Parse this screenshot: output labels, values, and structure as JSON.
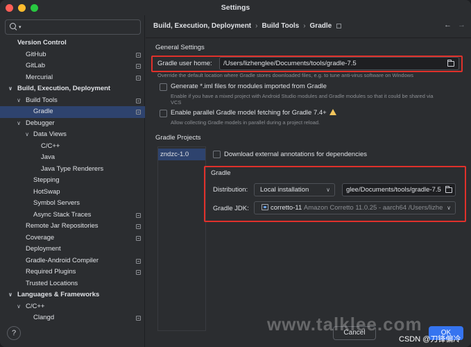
{
  "window": {
    "title": "Settings",
    "traffic_lights": {
      "close": "#ff5f57",
      "minimize": "#febc2e",
      "zoom": "#28c840"
    }
  },
  "sidebar": {
    "search": {
      "value": "",
      "icon": "search-icon"
    },
    "items": [
      {
        "label": "Version Control",
        "level": 1,
        "bold": true,
        "arrow": "",
        "page_icon": false,
        "selected": false
      },
      {
        "label": "GitHub",
        "level": 2,
        "bold": false,
        "arrow": "",
        "page_icon": true,
        "selected": false
      },
      {
        "label": "GitLab",
        "level": 2,
        "bold": false,
        "arrow": "",
        "page_icon": true,
        "selected": false
      },
      {
        "label": "Mercurial",
        "level": 2,
        "bold": false,
        "arrow": "",
        "page_icon": true,
        "selected": false
      },
      {
        "label": "Build, Execution, Deployment",
        "level": 1,
        "bold": true,
        "arrow": "∨",
        "page_icon": false,
        "selected": false
      },
      {
        "label": "Build Tools",
        "level": 2,
        "bold": false,
        "arrow": "∨",
        "page_icon": true,
        "selected": false
      },
      {
        "label": "Gradle",
        "level": 3,
        "bold": false,
        "arrow": "",
        "page_icon": true,
        "selected": true
      },
      {
        "label": "Debugger",
        "level": 2,
        "bold": false,
        "arrow": "∨",
        "page_icon": false,
        "selected": false
      },
      {
        "label": "Data Views",
        "level": 3,
        "bold": false,
        "arrow": "∨",
        "page_icon": false,
        "selected": false
      },
      {
        "label": "C/C++",
        "level": 4,
        "bold": false,
        "arrow": "",
        "page_icon": false,
        "selected": false
      },
      {
        "label": "Java",
        "level": 4,
        "bold": false,
        "arrow": "",
        "page_icon": false,
        "selected": false
      },
      {
        "label": "Java Type Renderers",
        "level": 4,
        "bold": false,
        "arrow": "",
        "page_icon": false,
        "selected": false
      },
      {
        "label": "Stepping",
        "level": 3,
        "bold": false,
        "arrow": "",
        "page_icon": false,
        "selected": false
      },
      {
        "label": "HotSwap",
        "level": 3,
        "bold": false,
        "arrow": "",
        "page_icon": false,
        "selected": false
      },
      {
        "label": "Symbol Servers",
        "level": 3,
        "bold": false,
        "arrow": "",
        "page_icon": false,
        "selected": false
      },
      {
        "label": "Async Stack Traces",
        "level": 3,
        "bold": false,
        "arrow": "",
        "page_icon": true,
        "selected": false
      },
      {
        "label": "Remote Jar Repositories",
        "level": 2,
        "bold": false,
        "arrow": "",
        "page_icon": true,
        "selected": false
      },
      {
        "label": "Coverage",
        "level": 2,
        "bold": false,
        "arrow": "",
        "page_icon": true,
        "selected": false
      },
      {
        "label": "Deployment",
        "level": 2,
        "bold": false,
        "arrow": "",
        "page_icon": false,
        "selected": false
      },
      {
        "label": "Gradle-Android Compiler",
        "level": 2,
        "bold": false,
        "arrow": "",
        "page_icon": true,
        "selected": false
      },
      {
        "label": "Required Plugins",
        "level": 2,
        "bold": false,
        "arrow": "",
        "page_icon": true,
        "selected": false
      },
      {
        "label": "Trusted Locations",
        "level": 2,
        "bold": false,
        "arrow": "",
        "page_icon": false,
        "selected": false
      },
      {
        "label": "Languages & Frameworks",
        "level": 1,
        "bold": true,
        "arrow": "∨",
        "page_icon": false,
        "selected": false
      },
      {
        "label": "C/C++",
        "level": 2,
        "bold": false,
        "arrow": "∨",
        "page_icon": false,
        "selected": false
      },
      {
        "label": "Clangd",
        "level": 3,
        "bold": false,
        "arrow": "",
        "page_icon": true,
        "selected": false
      }
    ],
    "help_label": "?"
  },
  "breadcrumb": {
    "items": [
      "Build, Execution, Deployment",
      "Build Tools",
      "Gradle"
    ],
    "separator": "›",
    "back": "←",
    "forward": "→"
  },
  "general": {
    "title": "General Settings",
    "user_home_label": "Gradle user home:",
    "user_home_value": "/Users/lizhenglee/Documents/tools/gradle-7.5",
    "user_home_hint": "Override the default location where Gradle stores downloaded files, e.g. to tune anti-virus software on Windows",
    "iml_label": "Generate *.iml files for modules imported from Gradle",
    "iml_checked": false,
    "iml_hint_1": "Enable if you have a mixed project with Android Studio modules and Gradle modules so that it could be shared via",
    "iml_hint_2": "VCS",
    "parallel_label": "Enable parallel Gradle model fetching for Gradle 7.4+",
    "parallel_checked": false,
    "parallel_hint": "Allow collecting Gradle models in parallel during a project reload."
  },
  "projects": {
    "title": "Gradle Projects",
    "list": [
      "zndzc-1.0"
    ],
    "download_annotations_label": "Download external annotations for dependencies",
    "download_annotations_checked": false
  },
  "gradle": {
    "title": "Gradle",
    "distribution_label": "Distribution:",
    "distribution_value": "Local installation",
    "distribution_path": "glee/Documents/tools/gradle-7.5",
    "jdk_label": "Gradle JDK:",
    "jdk_name": "corretto-11",
    "jdk_detail": "Amazon Corretto 11.0.25 - aarch64 /Users/lizhe"
  },
  "buttons": {
    "cancel": "Cancel",
    "ok": "OK"
  },
  "overlay": {
    "watermark": "www.talklee.com",
    "credit": "CSDN @刀锋偏冷"
  },
  "colors": {
    "highlight_box": "#e0312b",
    "selection": "#2e436e",
    "accent": "#3574f0",
    "background": "#2b2d30"
  }
}
